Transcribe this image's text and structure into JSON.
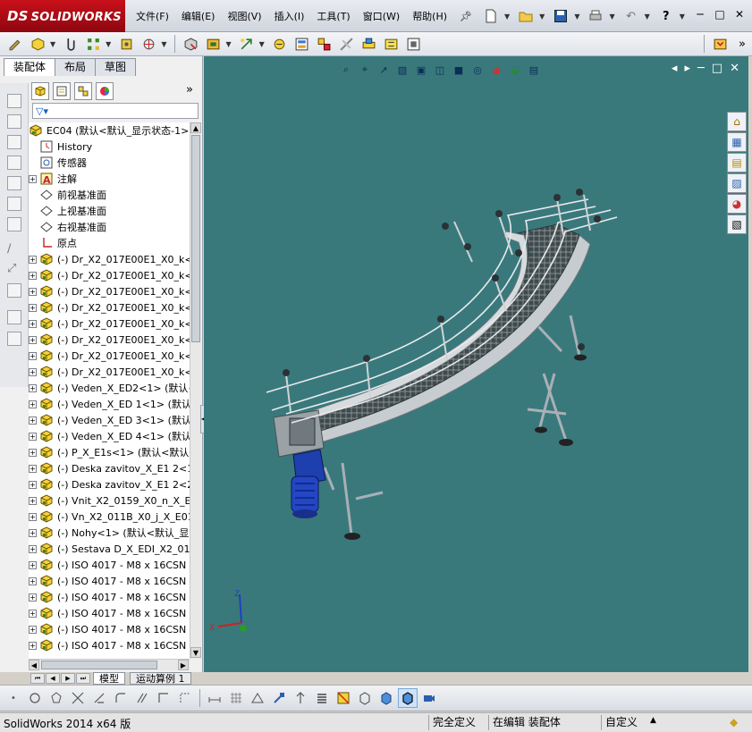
{
  "app": {
    "logo_text": "SOLIDWORKS",
    "logo_mark": "DS"
  },
  "menu": [
    "文件(F)",
    "编辑(E)",
    "视图(V)",
    "插入(I)",
    "工具(T)",
    "窗口(W)",
    "帮助(H)"
  ],
  "left_panel": {
    "tabs": [
      "装配体",
      "布局",
      "草图"
    ],
    "active_tab": 0,
    "tree": {
      "root": "EC04 (默认<默认_显示状态-1>",
      "items": [
        {
          "label": "History",
          "icon": "history-icon",
          "expand": false
        },
        {
          "label": "传感器",
          "icon": "sensor-icon",
          "expand": false
        },
        {
          "label": "注解",
          "icon": "annotation-icon",
          "expand": true
        },
        {
          "label": "前视基准面",
          "icon": "plane-icon",
          "expand": false
        },
        {
          "label": "上视基准面",
          "icon": "plane-icon",
          "expand": false
        },
        {
          "label": "右视基准面",
          "icon": "plane-icon",
          "expand": false
        },
        {
          "label": "原点",
          "icon": "origin-icon",
          "expand": false
        },
        {
          "label": "(-) Dr_X2_017E00E1_X0_k<1>",
          "icon": "part-icon",
          "expand": true
        },
        {
          "label": "(-) Dr_X2_017E00E1_X0_k<2>",
          "icon": "part-icon",
          "expand": true
        },
        {
          "label": "(-) Dr_X2_017E00E1_X0_k<3>",
          "icon": "part-icon",
          "expand": true
        },
        {
          "label": "(-) Dr_X2_017E00E1_X0_k<4>",
          "icon": "part-icon",
          "expand": true
        },
        {
          "label": "(-) Dr_X2_017E00E1_X0_k<5>",
          "icon": "part-icon",
          "expand": true
        },
        {
          "label": "(-) Dr_X2_017E00E1_X0_k<6>",
          "icon": "part-icon",
          "expand": true
        },
        {
          "label": "(-) Dr_X2_017E00E1_X0_k<7>",
          "icon": "part-icon",
          "expand": true
        },
        {
          "label": "(-) Dr_X2_017E00E1_X0_k<8>",
          "icon": "part-icon",
          "expand": true
        },
        {
          "label": "(-) Veden_X_ED2<1> (默认<",
          "icon": "part-icon",
          "expand": true
        },
        {
          "label": "(-) Veden_X_ED 1<1> (默认",
          "icon": "part-icon",
          "expand": true
        },
        {
          "label": "(-) Veden_X_ED 3<1> (默认",
          "icon": "part-icon",
          "expand": true
        },
        {
          "label": "(-) Veden_X_ED 4<1> (默认",
          "icon": "part-icon",
          "expand": true
        },
        {
          "label": "(-) P_X_E1s<1> (默认<默认",
          "icon": "part-icon",
          "expand": true
        },
        {
          "label": "(-) Deska zavitov_X_E1 2<1>",
          "icon": "part-icon",
          "expand": true
        },
        {
          "label": "(-) Deska zavitov_X_E1 2<2>",
          "icon": "part-icon",
          "expand": true
        },
        {
          "label": "(-) Vnit_X2_0159_X0_n_X_ED",
          "icon": "part-icon",
          "expand": true
        },
        {
          "label": "(-) Vn_X2_011B_X0_j_X_E01",
          "icon": "part-icon",
          "expand": true
        },
        {
          "label": "(-) Nohy<1> (默认<默认_显",
          "icon": "part-icon",
          "expand": true
        },
        {
          "label": "(-) Sestava D_X_EDI_X2_016",
          "icon": "part-icon",
          "expand": true
        },
        {
          "label": "(-) ISO 4017 - M8 x 16CSN EI",
          "icon": "part-icon",
          "expand": true
        },
        {
          "label": "(-) ISO 4017 - M8 x 16CSN EI",
          "icon": "part-icon",
          "expand": true
        },
        {
          "label": "(-) ISO 4017 - M8 x 16CSN EI",
          "icon": "part-icon",
          "expand": true
        },
        {
          "label": "(-) ISO 4017 - M8 x 16CSN EI",
          "icon": "part-icon",
          "expand": true
        },
        {
          "label": "(-) ISO 4017 - M8 x 16CSN EI",
          "icon": "part-icon",
          "expand": true
        },
        {
          "label": "(-) ISO 4017 - M8 x 16CSN EI",
          "icon": "part-icon",
          "expand": true
        }
      ]
    }
  },
  "bottom_tabs": [
    "模型",
    "运动算例 1"
  ],
  "status": {
    "app_version": "SolidWorks 2014 x64 版",
    "definition": "完全定义",
    "editing": "在编辑 装配体",
    "units": "自定义"
  },
  "colors": {
    "viewport_bg": "#39797c",
    "logo_red": "#b30b15",
    "frame_gray": "#c9ccd0",
    "motor_blue": "#1e3fae"
  }
}
